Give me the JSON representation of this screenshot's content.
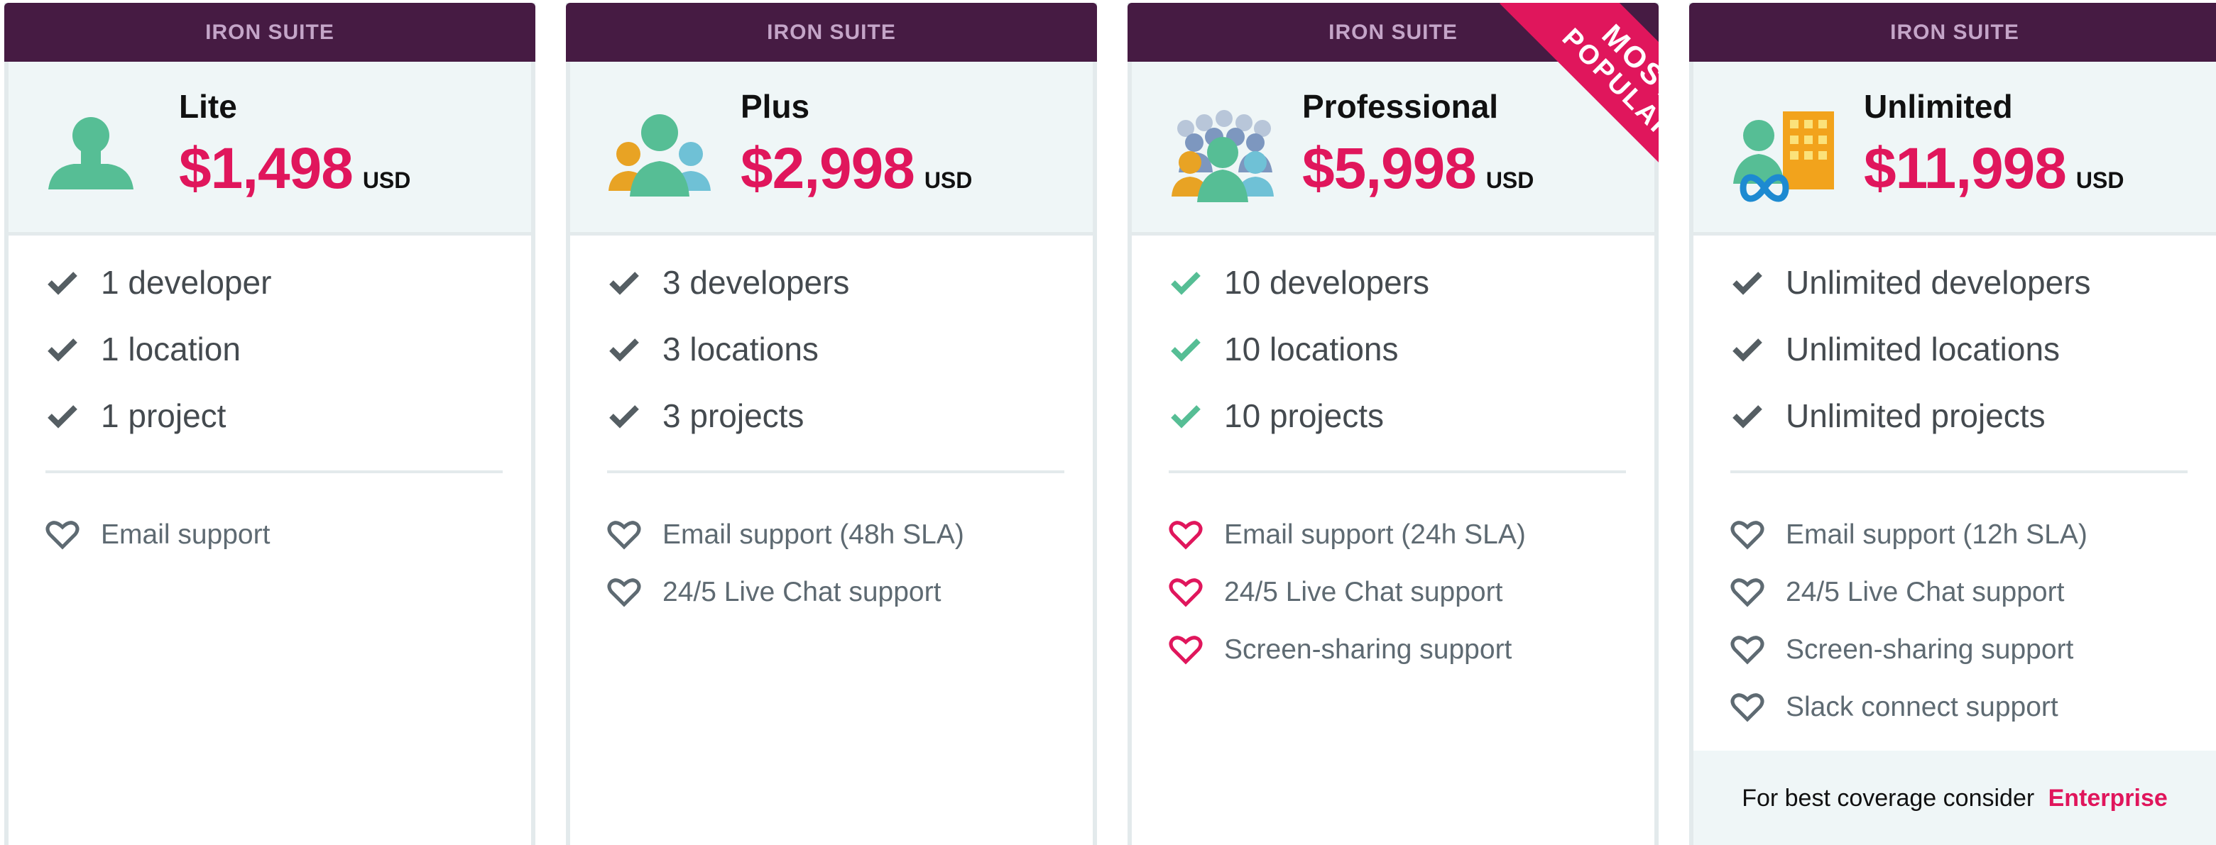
{
  "colors": {
    "banner": "#461b43",
    "banner_text": "#c4a5c8",
    "price": "#e0165c",
    "check_default": "#555e63",
    "check_popular": "#56be95",
    "heart_default": "#5e6a72",
    "heart_popular": "#e0165c",
    "head_bg": "#eff6f7"
  },
  "plans": [
    {
      "banner": "IRON SUITE",
      "name": "Lite",
      "price": "$1,498",
      "currency": "USD",
      "icon": "single-user-icon",
      "features": [
        "1 developer",
        "1 location",
        "1 project"
      ],
      "support": [
        "Email support"
      ]
    },
    {
      "banner": "IRON SUITE",
      "name": "Plus",
      "price": "$2,998",
      "currency": "USD",
      "icon": "three-users-icon",
      "features": [
        "3 developers",
        "3 locations",
        "3 projects"
      ],
      "support": [
        "Email support (48h SLA)",
        "24/5 Live Chat support"
      ]
    },
    {
      "banner": "IRON SUITE",
      "name": "Professional",
      "price": "$5,998",
      "currency": "USD",
      "icon": "team-users-icon",
      "ribbon": [
        "MOST",
        "POPULAR"
      ],
      "features": [
        "10 developers",
        "10 locations",
        "10 projects"
      ],
      "support": [
        "Email support (24h SLA)",
        "24/5 Live Chat support",
        "Screen-sharing support"
      ]
    },
    {
      "banner": "IRON SUITE",
      "name": "Unlimited",
      "price": "$11,998",
      "currency": "USD",
      "icon": "user-building-infinity-icon",
      "features": [
        "Unlimited developers",
        "Unlimited locations",
        "Unlimited projects"
      ],
      "support": [
        "Email support (12h SLA)",
        "24/5 Live Chat support",
        "Screen-sharing support",
        "Slack connect support"
      ],
      "note": "For best coverage consider",
      "note_link": "Enterprise"
    }
  ]
}
